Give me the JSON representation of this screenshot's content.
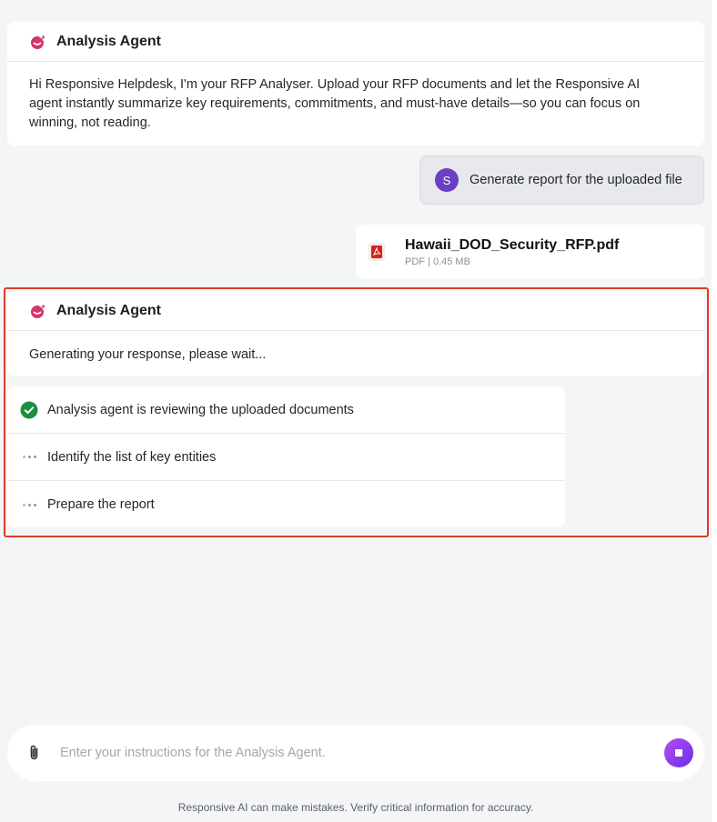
{
  "intro_card": {
    "agent_name": "Analysis Agent",
    "message": "Hi Responsive Helpdesk, I'm your RFP Analyser. Upload your RFP documents and let the Responsive AI agent instantly summarize key requirements, commitments, and must-have details—so you can focus on winning, not reading."
  },
  "user_message": {
    "avatar_initial": "S",
    "text": "Generate report for the uploaded file"
  },
  "attachment": {
    "file_name": "Hawaii_DOD_Security_RFP.pdf",
    "meta": "PDF | 0.45 MB",
    "icon": "pdf-icon"
  },
  "response_card": {
    "agent_name": "Analysis Agent",
    "status": "Generating your response, please wait..."
  },
  "steps": [
    {
      "label": "Analysis agent is reviewing the uploaded documents",
      "state": "done",
      "icon": "check-circle-icon"
    },
    {
      "label": "Identify the list of key entities",
      "state": "pending",
      "icon": "loading-dots-icon"
    },
    {
      "label": "Prepare the report",
      "state": "pending",
      "icon": "loading-dots-icon"
    }
  ],
  "composer": {
    "placeholder": "Enter your instructions for the Analysis Agent.",
    "value": "",
    "attach_icon": "paperclip-icon",
    "stop_icon": "stop-icon"
  },
  "footer": {
    "disclaimer": "Responsive AI can make mistakes. Verify critical information for accuracy."
  },
  "colors": {
    "accent": "#7b3fe8",
    "agent_icon": "#d6336c",
    "success": "#1e8e3e",
    "highlight_border": "#e0392b",
    "pdf_red": "#d0251b"
  }
}
